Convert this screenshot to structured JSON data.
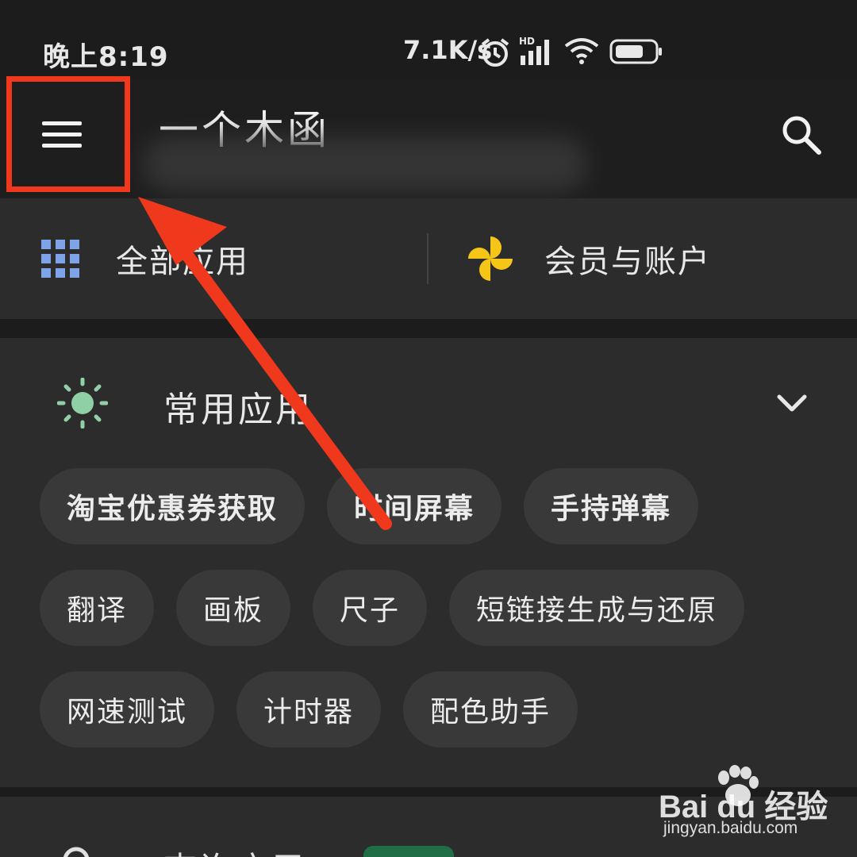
{
  "status_bar": {
    "time": "晚上8:19",
    "net_speed": "7.1K/s",
    "icons": [
      "alarm-icon",
      "hd-signal-icon",
      "wifi-icon",
      "battery-icon"
    ]
  },
  "app_bar": {
    "title": "一个木函",
    "menu_icon": "hamburger-menu-icon",
    "search_icon": "search-icon"
  },
  "top_row": {
    "all_apps_label": "全部应用",
    "vip_label": "会员与账户"
  },
  "common_apps": {
    "title": "常用应用",
    "chips": [
      {
        "label": "淘宝优惠券获取",
        "bold": true
      },
      {
        "label": "时间屏幕",
        "bold": true
      },
      {
        "label": "手持弹幕",
        "bold": true
      },
      {
        "label": "翻译",
        "bold": false
      },
      {
        "label": "画板",
        "bold": false
      },
      {
        "label": "尺子",
        "bold": false
      },
      {
        "label": "短链接生成与还原",
        "bold": false
      },
      {
        "label": "网速测试",
        "bold": false
      },
      {
        "label": "计时器",
        "bold": false
      },
      {
        "label": "配色助手",
        "bold": false
      }
    ]
  },
  "bottom_row": {
    "label": "查询应用",
    "badge": ""
  },
  "watermark": {
    "brand": "Bai du 经验",
    "url": "jingyan.baidu.com"
  },
  "colors": {
    "background": "#1c1c1c",
    "card": "#2c2c2c",
    "chip": "#393939",
    "annotation_red": "#f0381c",
    "grid_icon_blue": "#7ea3e6",
    "pinwheel_yellow": "#f5c518",
    "sun_green": "#8fd0a6"
  }
}
